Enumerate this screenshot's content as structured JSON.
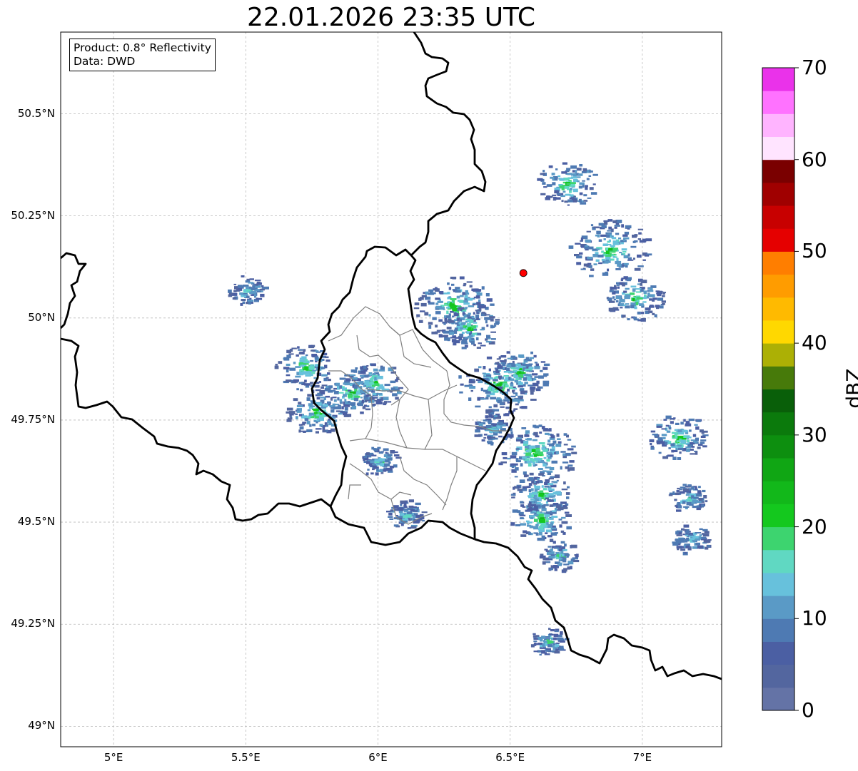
{
  "title": "22.01.2026 23:35 UTC",
  "infobox": {
    "product": "Product: 0.8° Reflectivity",
    "data": "Data: DWD"
  },
  "axes": {
    "lon_range": [
      4.8,
      7.3
    ],
    "lat_range": [
      48.95,
      50.7
    ],
    "x_ticks": [
      "5°E",
      "5.5°E",
      "6°E",
      "6.5°E",
      "7°E"
    ],
    "y_ticks": [
      "50.5°N",
      "50.25°N",
      "50°N",
      "49.75°N",
      "49.5°N",
      "49.25°N",
      "49°N"
    ],
    "grid": true
  },
  "radar_site": {
    "lon": 6.55,
    "lat": 50.11,
    "color": "#ff0000"
  },
  "colorbar": {
    "label": "dBZ",
    "min": 0,
    "max": 70,
    "ticks": [
      "0",
      "10",
      "20",
      "30",
      "40",
      "50",
      "60",
      "70"
    ],
    "colors": [
      "#6473a6",
      "#53669f",
      "#4b5fa3",
      "#4e7ab3",
      "#5a9ac6",
      "#67c1dc",
      "#60d8c2",
      "#3dd46f",
      "#14c81e",
      "#12b81a",
      "#10a614",
      "#0d8f0f",
      "#0b7a0c",
      "#095f09",
      "#477a0a",
      "#acb005",
      "#ffd800",
      "#ffba00",
      "#ff9c00",
      "#ff7e00",
      "#e50000",
      "#c80000",
      "#a00000",
      "#7a0000",
      "#ffe4ff",
      "#ffb4ff",
      "#ff72ff",
      "#ea32ea"
    ]
  },
  "echoes": [
    {
      "lon": 5.5,
      "lat": 50.07,
      "r": 1
    },
    {
      "lon": 5.72,
      "lat": 49.88,
      "r": 2
    },
    {
      "lon": 5.76,
      "lat": 49.77,
      "r": 2
    },
    {
      "lon": 5.89,
      "lat": 49.82,
      "r": 2
    },
    {
      "lon": 5.98,
      "lat": 49.84,
      "r": 2
    },
    {
      "lon": 6.28,
      "lat": 50.03,
      "r": 3
    },
    {
      "lon": 6.34,
      "lat": 49.98,
      "r": 2
    },
    {
      "lon": 6.45,
      "lat": 49.84,
      "r": 3
    },
    {
      "lon": 6.53,
      "lat": 49.87,
      "r": 2
    },
    {
      "lon": 6.59,
      "lat": 49.67,
      "r": 3
    },
    {
      "lon": 6.61,
      "lat": 49.57,
      "r": 2
    },
    {
      "lon": 6.61,
      "lat": 49.51,
      "r": 2
    },
    {
      "lon": 6.68,
      "lat": 49.42,
      "r": 1
    },
    {
      "lon": 6.71,
      "lat": 50.33,
      "r": 2
    },
    {
      "lon": 6.87,
      "lat": 50.17,
      "r": 3
    },
    {
      "lon": 6.97,
      "lat": 50.05,
      "r": 2
    },
    {
      "lon": 7.13,
      "lat": 49.71,
      "r": 2
    },
    {
      "lon": 7.17,
      "lat": 49.56,
      "r": 1
    },
    {
      "lon": 7.18,
      "lat": 49.46,
      "r": 1
    },
    {
      "lon": 6.64,
      "lat": 49.21,
      "r": 1
    },
    {
      "lon": 6.0,
      "lat": 49.65,
      "r": 1
    },
    {
      "lon": 6.1,
      "lat": 49.52,
      "r": 1
    },
    {
      "lon": 6.43,
      "lat": 49.73,
      "r": 1
    }
  ]
}
